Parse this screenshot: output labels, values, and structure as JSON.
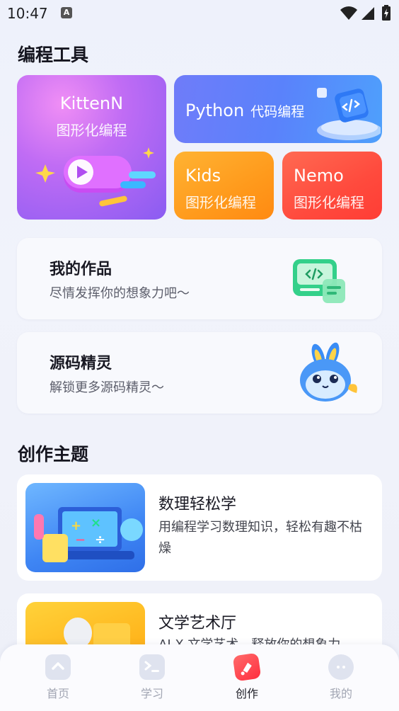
{
  "status_bar": {
    "time": "10:47",
    "notification_icon": "A"
  },
  "tools_section": {
    "title": "编程工具",
    "tools": [
      {
        "name": "KittenN",
        "subtitle": "图形化编程"
      },
      {
        "name": "Python",
        "subtitle": "代码编程"
      },
      {
        "name": "Kids",
        "subtitle": "图形化编程"
      },
      {
        "name": "Nemo",
        "subtitle": "图形化编程"
      }
    ]
  },
  "cards": [
    {
      "title": "我的作品",
      "subtitle": "尽情发挥你的想象力吧～",
      "icon": "code-window-icon"
    },
    {
      "title": "源码精灵",
      "subtitle": "解锁更多源码精灵～",
      "icon": "sprite-mascot-icon"
    }
  ],
  "topics_section": {
    "title": "创作主题",
    "topics": [
      {
        "title": "数理轻松学",
        "desc": "用编程学习数理知识，轻松有趣不枯燥"
      },
      {
        "title": "文学艺术厅",
        "desc": "AI X 文学艺术，释放你的想象力"
      }
    ]
  },
  "nav": {
    "items": [
      {
        "label": "首页",
        "icon": "home-icon",
        "active": false
      },
      {
        "label": "学习",
        "icon": "terminal-icon",
        "active": false
      },
      {
        "label": "创作",
        "icon": "create-icon",
        "active": true
      },
      {
        "label": "我的",
        "icon": "profile-icon",
        "active": false
      }
    ]
  },
  "colors": {
    "kitten": "#b56bf4",
    "python": "#5a82fb",
    "kids": "#ff9f22",
    "nemo": "#ff4a3d",
    "nav_active": "#1d1d26",
    "nav_inactive": "#a2a6b3"
  }
}
